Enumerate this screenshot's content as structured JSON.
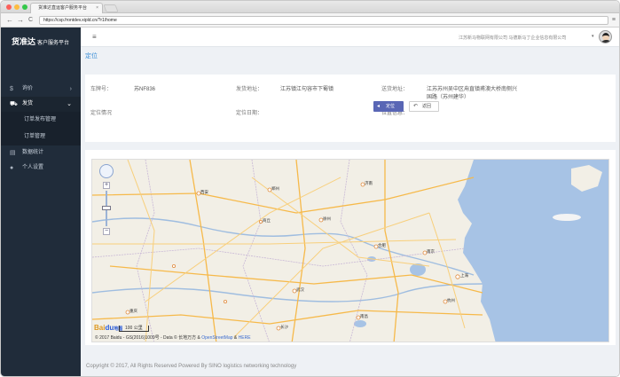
{
  "browser": {
    "tab_title": "货准达直运客户服务平台",
    "tab_close": "×",
    "url": "https://csp.frontdev.xipld.cn/?r1/home",
    "back": "←",
    "forward": "→",
    "reload": "C",
    "menu": "≡",
    "colors": {
      "close": "#fc605b",
      "minimize": "#fdbc40",
      "maximize": "#34c84a"
    }
  },
  "sidebar": {
    "brand_name": "货准达",
    "brand_sub": "客户服务平台",
    "items": [
      {
        "label": "询价",
        "icon": "dollar-icon",
        "glyph": "$",
        "chevron": "›"
      },
      {
        "label": "发货",
        "icon": "truck-icon",
        "glyph": "⛟",
        "chevron": "⌄",
        "active": true,
        "children": [
          "订单发布管理",
          "订单管理"
        ]
      },
      {
        "label": "数据统计",
        "icon": "chart-icon",
        "glyph": "▤"
      },
      {
        "label": "个人设置",
        "icon": "user-icon",
        "glyph": "●"
      }
    ]
  },
  "header": {
    "menu_glyph": "≡",
    "company": "江苏新马物联网有限公司 马德斯马丁企业信息有限公司",
    "caret": "▾"
  },
  "page": {
    "title": "定位"
  },
  "info": {
    "plate_label": "车牌号：",
    "plate_value": "苏NF836",
    "origin_label": "发货地址：",
    "origin_value": "江苏镇江句容市下蜀镇",
    "dest_label": "送货地址：",
    "dest_value_line1": "江苏苏州吴中区甪直镇甫澳大桥南侧兴",
    "dest_value_line2": "国路（苏州建华）",
    "status_label": "定位情况",
    "date_label": "定位日期：",
    "pos_label": "位置信息：",
    "locate_button": "定位",
    "locate_glyph": "◂",
    "back_button": "返回",
    "back_glyph": "↶",
    "primary_color": "#5966b5"
  },
  "map": {
    "logo_a": "Bai",
    "logo_b": "du",
    "logo_c": "地图",
    "scale_label": "100 公里",
    "copyright": "© 2017 Baidu - GS(2016)1009号 - Data © 长地万方 &",
    "osm": "OpenStreetMap",
    "here_sep": "&",
    "here": "HERE",
    "zoom_in": "+",
    "zoom_out": "−",
    "cities": [
      "西安",
      "郑州",
      "济南",
      "徐州",
      "合肥",
      "南京",
      "武汉",
      "上海",
      "杭州",
      "长沙",
      "南昌",
      "重庆",
      "商丘"
    ]
  },
  "footer": {
    "text": "Copyright © 2017, All Rights Reserved Powered By SINO logistics networking technology"
  }
}
